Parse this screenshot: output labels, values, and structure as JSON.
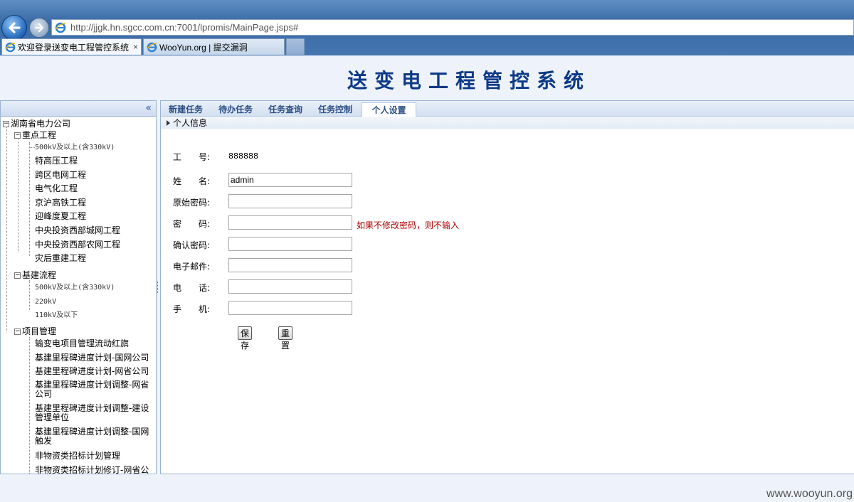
{
  "browser": {
    "url": "http://jjgk.hn.sgcc.com.cn:7001/lpromis/MainPage.jsps#",
    "tabs": [
      {
        "label": "欢迎登录送变电工程管控系统",
        "close": "×"
      },
      {
        "label": "WooYun.org | 提交漏洞"
      }
    ]
  },
  "header": {
    "title": "送变电工程管控系统"
  },
  "sidebar": {
    "collapse_label": "«",
    "root": "湖南省电力公司",
    "groups": [
      {
        "label": "重点工程",
        "items": [
          "500kV及以上(含330kV)",
          "特高压工程",
          "跨区电网工程",
          "电气化工程",
          "京沪高铁工程",
          "迎峰度夏工程",
          "中央投资西部城网工程",
          "中央投资西部农网工程",
          "灾后重建工程"
        ]
      },
      {
        "label": "基建流程",
        "items": [
          "500kV及以上(含330kV)",
          "220kV",
          "110kV及以下"
        ]
      },
      {
        "label": "项目管理",
        "items": [
          "输变电项目管理流动红旗",
          "基建里程碑进度计划-国网公司",
          "基建里程碑进度计划-网省公司",
          "基建里程碑进度计划调整-网省公司",
          "基建里程碑进度计划调整-建设管理单位",
          "基建里程碑进度计划调整-国网触发",
          "非物资类招标计划管理",
          "非物资类招标计划修订-网省公"
        ]
      }
    ]
  },
  "menu": {
    "items": [
      "新建任务",
      "待办任务",
      "任务查询",
      "任务控制",
      "个人设置"
    ],
    "active": "个人设置"
  },
  "breadcrumb": "个人信息",
  "form": {
    "employee_id_label": "工　　号:",
    "employee_id": "888888",
    "name_label": "姓　　名:",
    "name_value": "admin",
    "old_password_label": "原始密码:",
    "password_label": "密　　码:",
    "password_hint": "如果不修改密码，则不输入",
    "confirm_label": "确认密码:",
    "email_label": "电子邮件:",
    "phone_label": "电　　话:",
    "mobile_label": "手　　机:",
    "save_label": "保存",
    "reset_label": "重置"
  },
  "watermark": "www.wooyun.org"
}
